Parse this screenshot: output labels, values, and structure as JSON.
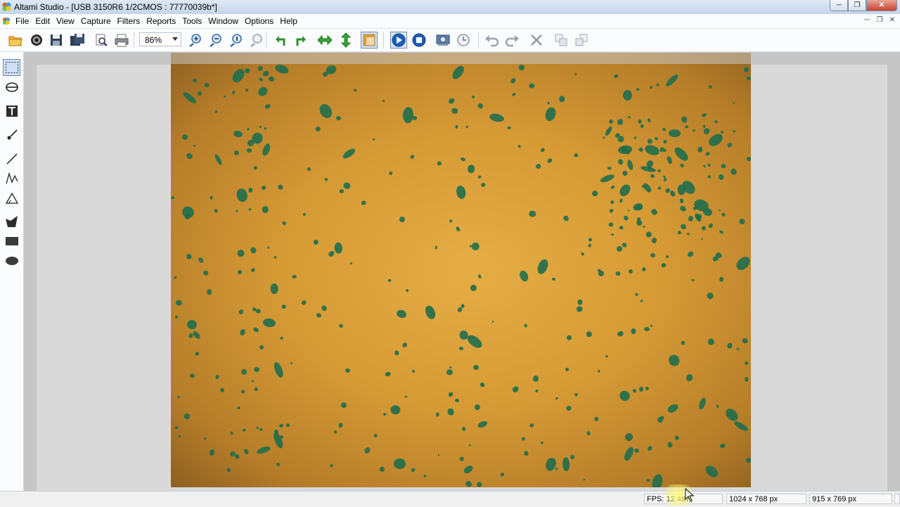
{
  "window": {
    "title": "Altami Studio - [USB 3150R6 1/2CMOS : 77770039b*]",
    "controls": [
      "minimize",
      "restore",
      "close"
    ]
  },
  "menu": {
    "items": [
      "File",
      "Edit",
      "View",
      "Capture",
      "Filters",
      "Reports",
      "Tools",
      "Window",
      "Options",
      "Help"
    ],
    "mdi_controls": [
      "minimize",
      "restore",
      "close"
    ]
  },
  "toolbar": {
    "zoom_value": "86%",
    "buttons": [
      "open-icon",
      "camera-icon",
      "save-icon",
      "save-all-icon",
      "print-preview-icon",
      "print-icon",
      "zoom-in-icon",
      "zoom-out-icon",
      "zoom-actual-icon",
      "zoom-fit-icon",
      "rotate-left-icon",
      "rotate-right-icon",
      "flip-horizontal-icon",
      "flip-vertical-icon",
      "panel-icon",
      "play-icon",
      "stop-icon",
      "capture-icon",
      "timer-icon",
      "undo-icon",
      "redo-icon",
      "delete-icon",
      "copy-icon",
      "paste-icon"
    ],
    "active_tools": [
      "panel-icon",
      "play-icon"
    ]
  },
  "left_tools": [
    "select-rectangle-icon",
    "rotate-tool-icon",
    "text-tool-icon",
    "brush-icon",
    "line-icon",
    "polyline-icon",
    "angle-icon",
    "polygon-icon",
    "rectangle-icon",
    "ellipse-icon"
  ],
  "colors": {
    "sample_bg": "#d69a35",
    "cell_stain": "#1f6e4e",
    "workspace": "#c6c6c6"
  },
  "status": {
    "fps": "FPS: 12.487",
    "image_size": "1024 x 768 px",
    "view_size": "915 x 769 px"
  }
}
